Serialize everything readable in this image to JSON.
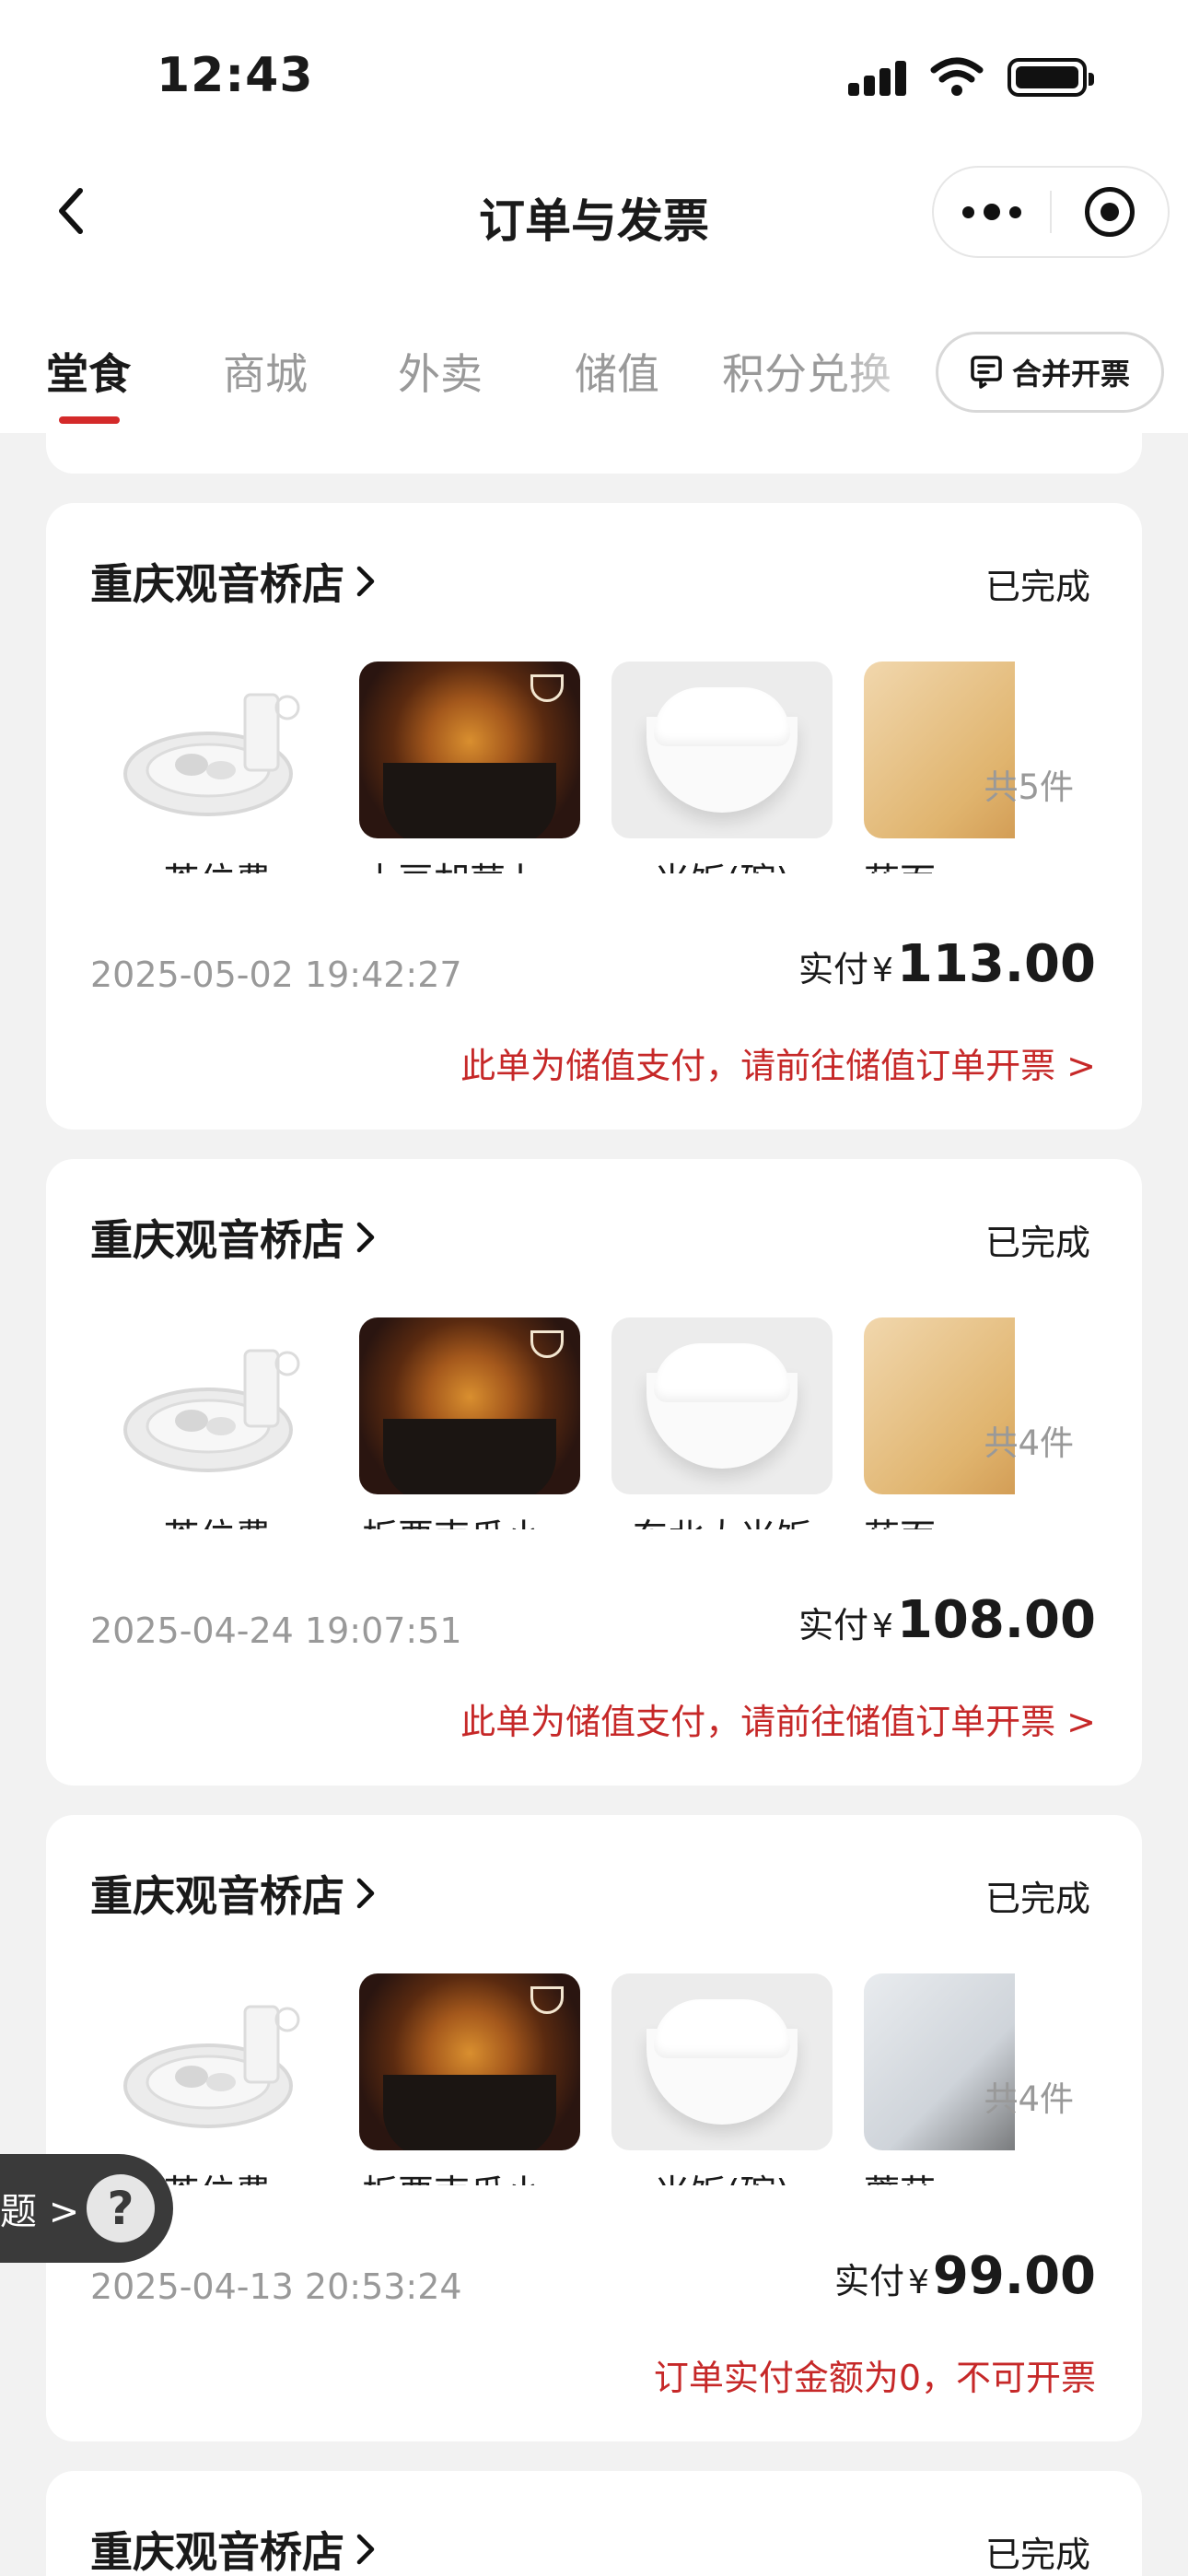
{
  "status_bar": {
    "time": "12:43"
  },
  "nav": {
    "title": "订单与发票"
  },
  "tabs": [
    {
      "label": "堂食",
      "active": true
    },
    {
      "label": "商城",
      "active": false
    },
    {
      "label": "外卖",
      "active": false
    },
    {
      "label": "储值",
      "active": false
    },
    {
      "label": "积分兑换",
      "active": false
    }
  ],
  "merge_invoice_label": "合并开票",
  "orders": [
    {
      "store": "重庆观音桥店",
      "status": "已完成",
      "items": [
        "茶位费",
        "土豆胡萝卜…",
        "米饭(碗)",
        "莜面"
      ],
      "count": "共5件",
      "datetime": "2025-05-02 19:42:27",
      "paid_label": "实付",
      "currency": "¥",
      "amount": "113.00",
      "note": "此单为储值支付，请前往储值订单开票 >"
    },
    {
      "store": "重庆观音桥店",
      "status": "已完成",
      "items": [
        "茶位费",
        "板栗南瓜小…",
        "东北大米饭",
        "莜面"
      ],
      "count": "共4件",
      "datetime": "2025-04-24 19:07:51",
      "paid_label": "实付",
      "currency": "¥",
      "amount": "108.00",
      "note": "此单为储值支付，请前往储值订单开票 >"
    },
    {
      "store": "重庆观音桥店",
      "status": "已完成",
      "items": [
        "茶位费",
        "板栗南瓜小…",
        "米饭(碗)",
        "蘑菇"
      ],
      "count": "共4件",
      "datetime": "2025-04-13 20:53:24",
      "paid_label": "实付",
      "currency": "¥",
      "amount": "99.00",
      "note": "订单实付金额为0，不可开票"
    },
    {
      "store": "重庆观音桥店",
      "status": "已完成"
    }
  ],
  "help_float": {
    "text": "题 >",
    "icon_label": "?"
  }
}
